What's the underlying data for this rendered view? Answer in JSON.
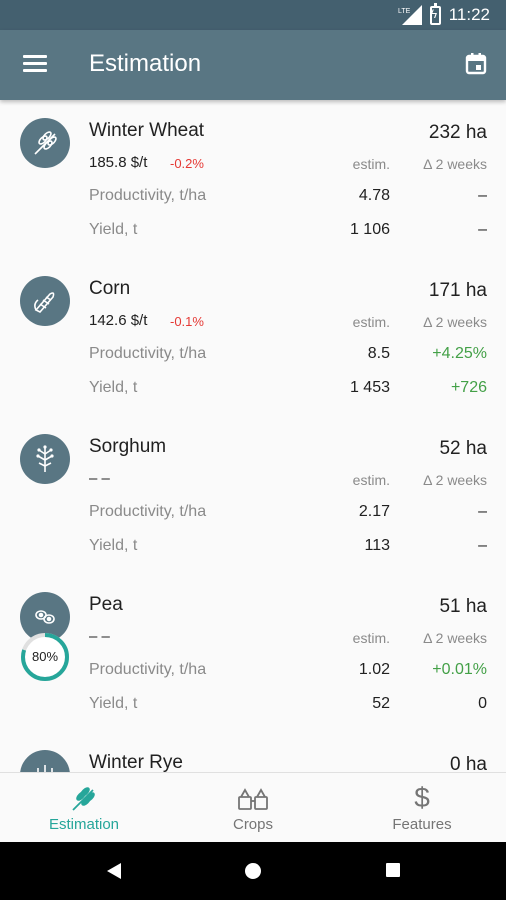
{
  "status": {
    "time": "11:22",
    "network": "LTE"
  },
  "app_bar": {
    "title": "Estimation"
  },
  "crops": [
    {
      "name": "Winter Wheat",
      "area": "232 ha",
      "price": "185.8 $/t",
      "price_change": "-0.2%",
      "estim_label": "estim.",
      "delta_label": "Δ 2 weeks",
      "rows": [
        {
          "label": "Productivity, t/ha",
          "estim": "4.78",
          "delta": "–"
        },
        {
          "label": "Yield, t",
          "estim": "1 106",
          "delta": "–"
        }
      ]
    },
    {
      "name": "Corn",
      "area": "171 ha",
      "price": "142.6 $/t",
      "price_change": "-0.1%",
      "estim_label": "estim.",
      "delta_label": "Δ 2 weeks",
      "rows": [
        {
          "label": "Productivity, t/ha",
          "estim": "8.5",
          "delta": "+4.25%"
        },
        {
          "label": "Yield, t",
          "estim": "1 453",
          "delta": "+726"
        }
      ]
    },
    {
      "name": "Sorghum",
      "area": "52 ha",
      "price": "– –",
      "price_change": "",
      "estim_label": "estim.",
      "delta_label": "Δ 2 weeks",
      "rows": [
        {
          "label": "Productivity, t/ha",
          "estim": "2.17",
          "delta": "–"
        },
        {
          "label": "Yield, t",
          "estim": "113",
          "delta": "–"
        }
      ]
    },
    {
      "name": "Pea",
      "area": "51 ha",
      "price": "– –",
      "price_change": "",
      "estim_label": "estim.",
      "delta_label": "Δ 2 weeks",
      "progress": "80%",
      "rows": [
        {
          "label": "Productivity, t/ha",
          "estim": "1.02",
          "delta": "+0.01%"
        },
        {
          "label": "Yield, t",
          "estim": "52",
          "delta": "0"
        }
      ]
    },
    {
      "name": "Winter Rye",
      "area": "0 ha"
    }
  ],
  "bottom_nav": {
    "items": [
      {
        "label": "Estimation",
        "icon": "wheat-icon",
        "active": true
      },
      {
        "label": "Crops",
        "icon": "crops-icon"
      },
      {
        "label": "Features",
        "icon": "dollar-icon"
      }
    ]
  },
  "colors": {
    "app_bar": "#597683",
    "status_bar": "#44606f",
    "accent": "#26a69a",
    "negative": "#e53935",
    "positive": "#43a047"
  }
}
